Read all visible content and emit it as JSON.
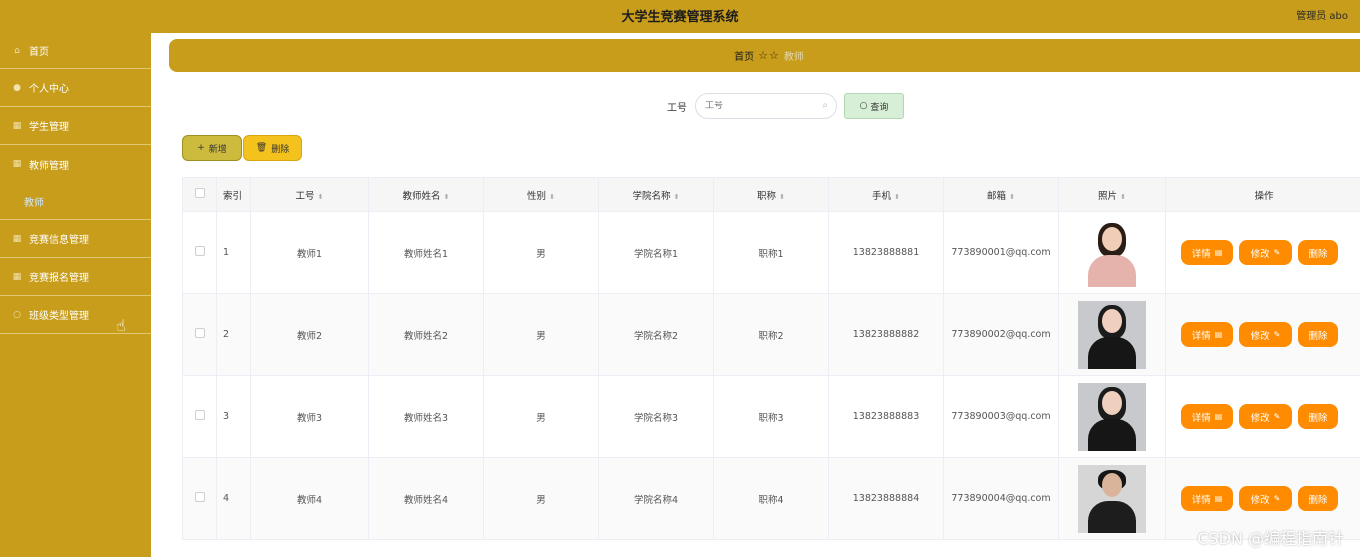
{
  "header": {
    "title": "大学生竞赛管理系统",
    "user": "管理员 abo"
  },
  "sidebar": {
    "items": [
      {
        "label": "首页",
        "icon": "home-icon",
        "glyph": "⌂"
      },
      {
        "label": "个人中心",
        "icon": "user-icon",
        "glyph": "●"
      },
      {
        "label": "学生管理",
        "icon": "grid-icon",
        "glyph": "▦"
      },
      {
        "label": "教师管理",
        "icon": "grid-icon",
        "glyph": "▦",
        "children": [
          "教师"
        ]
      },
      {
        "label": "竞赛信息管理",
        "icon": "grid-icon",
        "glyph": "▦"
      },
      {
        "label": "竞赛报名管理",
        "icon": "grid-icon",
        "glyph": "▦"
      },
      {
        "label": "班级类型管理",
        "icon": "settings-icon",
        "glyph": "○"
      }
    ]
  },
  "breadcrumb": {
    "home": "首页",
    "stars": "☆☆",
    "current": "教师"
  },
  "search": {
    "label": "工号",
    "placeholder": "工号",
    "button": "查询"
  },
  "actions": {
    "add": "新增",
    "delete": "删除"
  },
  "table": {
    "headers": [
      "索引",
      "工号",
      "教师姓名",
      "性别",
      "学院名称",
      "职称",
      "手机",
      "邮箱",
      "照片",
      "操作"
    ],
    "rows": [
      {
        "index": "1",
        "id": "教师1",
        "name": "教师姓名1",
        "gender": "男",
        "college": "学院名称1",
        "title": "职称1",
        "phone": "13823888881",
        "email": "773890001@qq.com"
      },
      {
        "index": "2",
        "id": "教师2",
        "name": "教师姓名2",
        "gender": "男",
        "college": "学院名称2",
        "title": "职称2",
        "phone": "13823888882",
        "email": "773890002@qq.com"
      },
      {
        "index": "3",
        "id": "教师3",
        "name": "教师姓名3",
        "gender": "男",
        "college": "学院名称3",
        "title": "职称3",
        "phone": "13823888883",
        "email": "773890003@qq.com"
      },
      {
        "index": "4",
        "id": "教师4",
        "name": "教师姓名4",
        "gender": "男",
        "college": "学院名称4",
        "title": "职称4",
        "phone": "13823888884",
        "email": "773890004@qq.com"
      }
    ],
    "row_actions": {
      "detail": "详情",
      "edit": "修改",
      "delete": "删除"
    }
  },
  "watermark": "CSDN @编程指南针",
  "colors": {
    "theme": "#c89d1c",
    "action": "#ff8c00",
    "add": "#cdbb3d",
    "delete": "#f4c21c"
  }
}
